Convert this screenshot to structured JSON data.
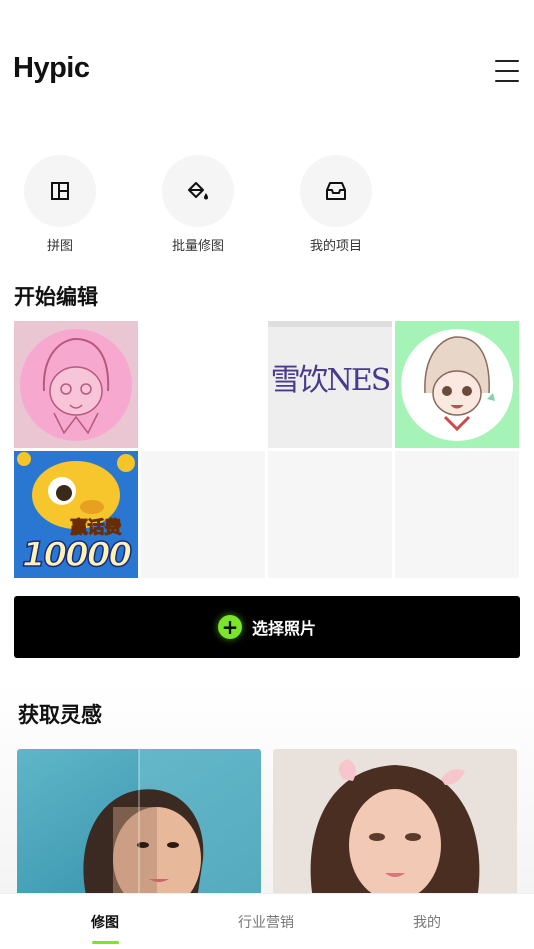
{
  "header": {
    "logo": "Hypic",
    "menu_icon": "hamburger-menu-icon"
  },
  "quick_actions": [
    {
      "label": "拼图",
      "icon": "collage-layout-icon"
    },
    {
      "label": "批量修图",
      "icon": "paint-bucket-icon"
    },
    {
      "label": "我的项目",
      "icon": "inbox-tray-icon"
    }
  ],
  "start_edit": {
    "title": "开始编辑",
    "thumbnails": [
      {
        "kind": "image",
        "desc": "pink anime girl sticker"
      },
      {
        "kind": "blank"
      },
      {
        "kind": "image",
        "text": "雪饮NES"
      },
      {
        "kind": "image",
        "desc": "anime girl sticker on green background"
      },
      {
        "kind": "image",
        "text": "赢话费",
        "number": "10000"
      },
      {
        "kind": "empty"
      },
      {
        "kind": "empty"
      },
      {
        "kind": "empty"
      }
    ]
  },
  "select_button": {
    "label": "选择照片",
    "icon": "plus-circle-icon",
    "accent": "#7be52c"
  },
  "inspiration": {
    "title": "获取灵感"
  },
  "tab_bar": {
    "tabs": [
      {
        "label": "修图",
        "active": true
      },
      {
        "label": "行业营销",
        "active": false
      },
      {
        "label": "我的",
        "active": false
      }
    ],
    "indicator_color": "#7be52c"
  }
}
